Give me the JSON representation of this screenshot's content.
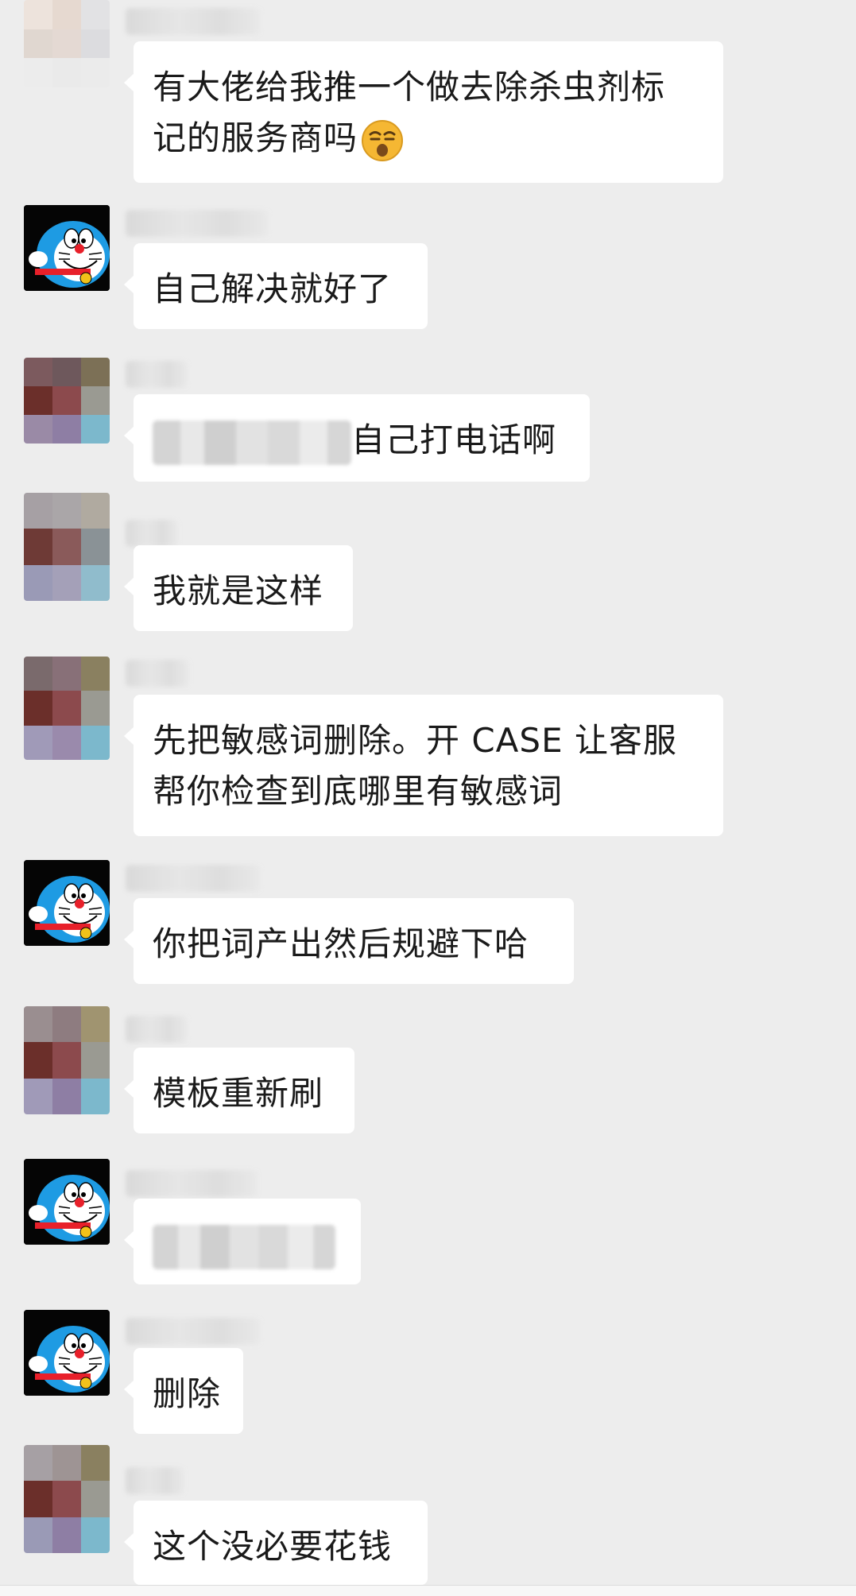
{
  "messages": [
    {
      "avatar": "pixelated-avatar",
      "text_lines": [
        "有大佬给我推一个做去除杀虫剂标",
        "记的服务商吗"
      ],
      "emoji": "smirk-emoji"
    },
    {
      "avatar": "doraemon-avatar",
      "text_lines": [
        "自己解决就好了"
      ]
    },
    {
      "avatar": "pixelated-avatar",
      "text_lines": [
        "自己打电话啊"
      ],
      "redacted_prefix": true
    },
    {
      "avatar": "pixelated-avatar",
      "text_lines": [
        "我就是这样"
      ]
    },
    {
      "avatar": "pixelated-avatar",
      "text_lines": [
        "先把敏感词删除。开 CASE 让客服",
        "帮你检查到底哪里有敏感词"
      ]
    },
    {
      "avatar": "doraemon-avatar",
      "text_lines": [
        "你把词产出然后规避下哈"
      ]
    },
    {
      "avatar": "pixelated-avatar",
      "text_lines": [
        "模板重新刷"
      ]
    },
    {
      "avatar": "doraemon-avatar",
      "text_lines": [],
      "redacted": true
    },
    {
      "avatar": "doraemon-avatar",
      "text_lines": [
        "删除"
      ]
    },
    {
      "avatar": "pixelated-avatar",
      "text_lines": [
        "这个没必要花钱"
      ]
    }
  ],
  "colors": {
    "background": "#ededed",
    "bubble": "#ffffff",
    "text": "#1a1a1a"
  }
}
